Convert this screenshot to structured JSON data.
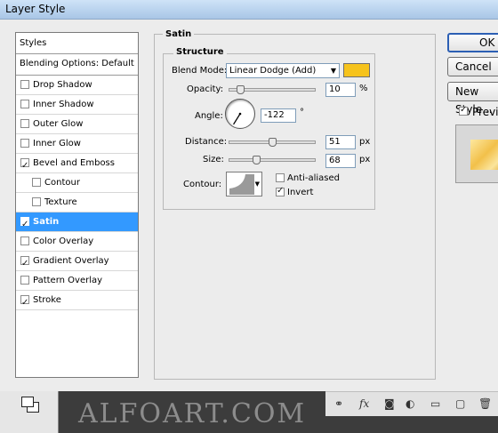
{
  "window": {
    "title": "Layer Style"
  },
  "styles_list": {
    "header": "Styles",
    "blending": "Blending Options: Default",
    "items": [
      {
        "label": "Drop Shadow",
        "checked": false,
        "sub": false,
        "selected": false
      },
      {
        "label": "Inner Shadow",
        "checked": false,
        "sub": false,
        "selected": false
      },
      {
        "label": "Outer Glow",
        "checked": false,
        "sub": false,
        "selected": false
      },
      {
        "label": "Inner Glow",
        "checked": false,
        "sub": false,
        "selected": false
      },
      {
        "label": "Bevel and Emboss",
        "checked": true,
        "sub": false,
        "selected": false
      },
      {
        "label": "Contour",
        "checked": false,
        "sub": true,
        "selected": false
      },
      {
        "label": "Texture",
        "checked": false,
        "sub": true,
        "selected": false
      },
      {
        "label": "Satin",
        "checked": true,
        "sub": false,
        "selected": true
      },
      {
        "label": "Color Overlay",
        "checked": false,
        "sub": false,
        "selected": false
      },
      {
        "label": "Gradient Overlay",
        "checked": true,
        "sub": false,
        "selected": false
      },
      {
        "label": "Pattern Overlay",
        "checked": false,
        "sub": false,
        "selected": false
      },
      {
        "label": "Stroke",
        "checked": true,
        "sub": false,
        "selected": false
      }
    ]
  },
  "satin": {
    "group_title": "Satin",
    "structure_title": "Structure",
    "blend_mode_label": "Blend Mode:",
    "blend_mode_value": "Linear Dodge (Add)",
    "blend_color": "#f6c31c",
    "opacity_label": "Opacity:",
    "opacity_value": "10",
    "opacity_unit": "%",
    "angle_label": "Angle:",
    "angle_value": "-122",
    "angle_unit": "°",
    "distance_label": "Distance:",
    "distance_value": "51",
    "distance_unit": "px",
    "size_label": "Size:",
    "size_value": "68",
    "size_unit": "px",
    "contour_label": "Contour:",
    "anti_aliased_label": "Anti-aliased",
    "anti_aliased_checked": false,
    "invert_label": "Invert",
    "invert_checked": true
  },
  "buttons": {
    "ok": "OK",
    "cancel": "Cancel",
    "new_style": "New Style...",
    "preview_label": "Preview",
    "preview_checked": true
  },
  "watermark": "ALFOART.COM"
}
